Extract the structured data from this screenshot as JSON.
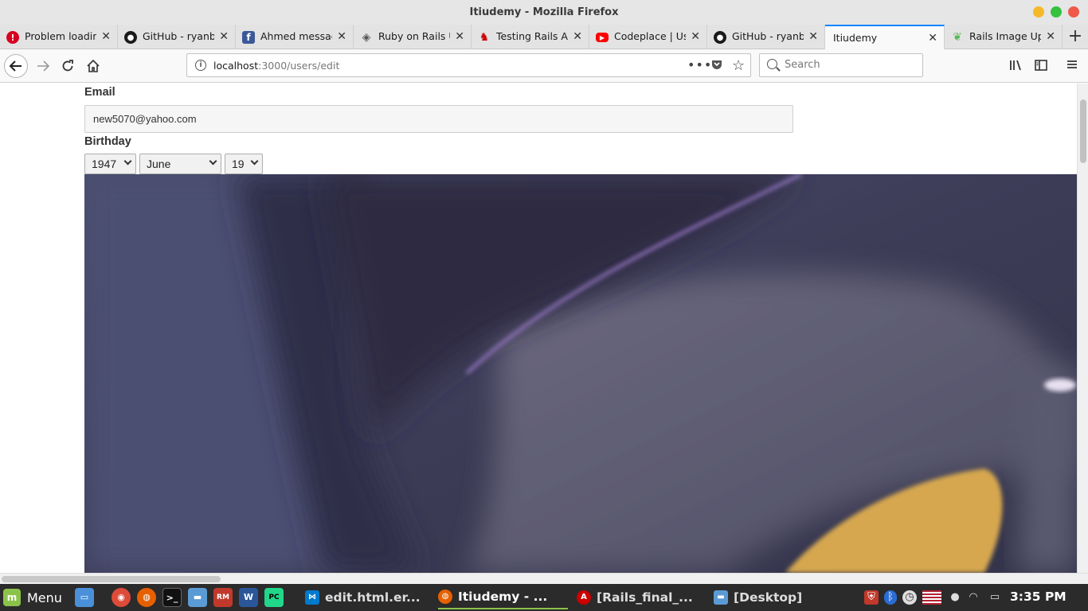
{
  "window": {
    "title": "Itiudemy - Mozilla Firefox"
  },
  "tabs": [
    {
      "label": "Problem loading",
      "favicon": "error-icon",
      "active": false
    },
    {
      "label": "GitHub - ryanb/",
      "favicon": "github-icon",
      "active": false
    },
    {
      "label": "Ahmed messag",
      "favicon": "facebook-icon",
      "active": false
    },
    {
      "label": "Ruby on Rails U",
      "favicon": "rails-icon",
      "active": false
    },
    {
      "label": "Testing Rails Ap",
      "favicon": "rails-red-icon",
      "active": false
    },
    {
      "label": "Codeplace | Us",
      "favicon": "youtube-icon",
      "active": false
    },
    {
      "label": "GitHub - ryanb/",
      "favicon": "github-icon",
      "active": false
    },
    {
      "label": "Itiudemy",
      "favicon": "",
      "active": true
    },
    {
      "label": "Rails Image Upl",
      "favicon": "leaf-icon",
      "active": false
    }
  ],
  "navbar": {
    "url_host": "localhost",
    "url_path": ":3000/users/edit",
    "search_placeholder": "Search"
  },
  "form": {
    "email_label": "Email",
    "email_value": "new5070@yahoo.com",
    "birthday_label": "Birthday",
    "birthday_year": "1947",
    "birthday_month": "June",
    "birthday_day": "19"
  },
  "taskbar": {
    "menu_label": "Menu",
    "windows": [
      {
        "label": "edit.html.er...",
        "icon": "vscode-icon",
        "active": false
      },
      {
        "label": "Itiudemy - ...",
        "icon": "firefox-icon",
        "active": true
      },
      {
        "label": "[Rails_final_...",
        "icon": "ruby-icon",
        "active": false
      },
      {
        "label": "[Desktop]",
        "icon": "folder-icon",
        "active": false
      }
    ],
    "clock": "3:35 PM"
  },
  "colors": {
    "accent": "#0a84ff",
    "taskbar_bg": "#2b2b2b",
    "mint_green": "#8bc34a"
  }
}
